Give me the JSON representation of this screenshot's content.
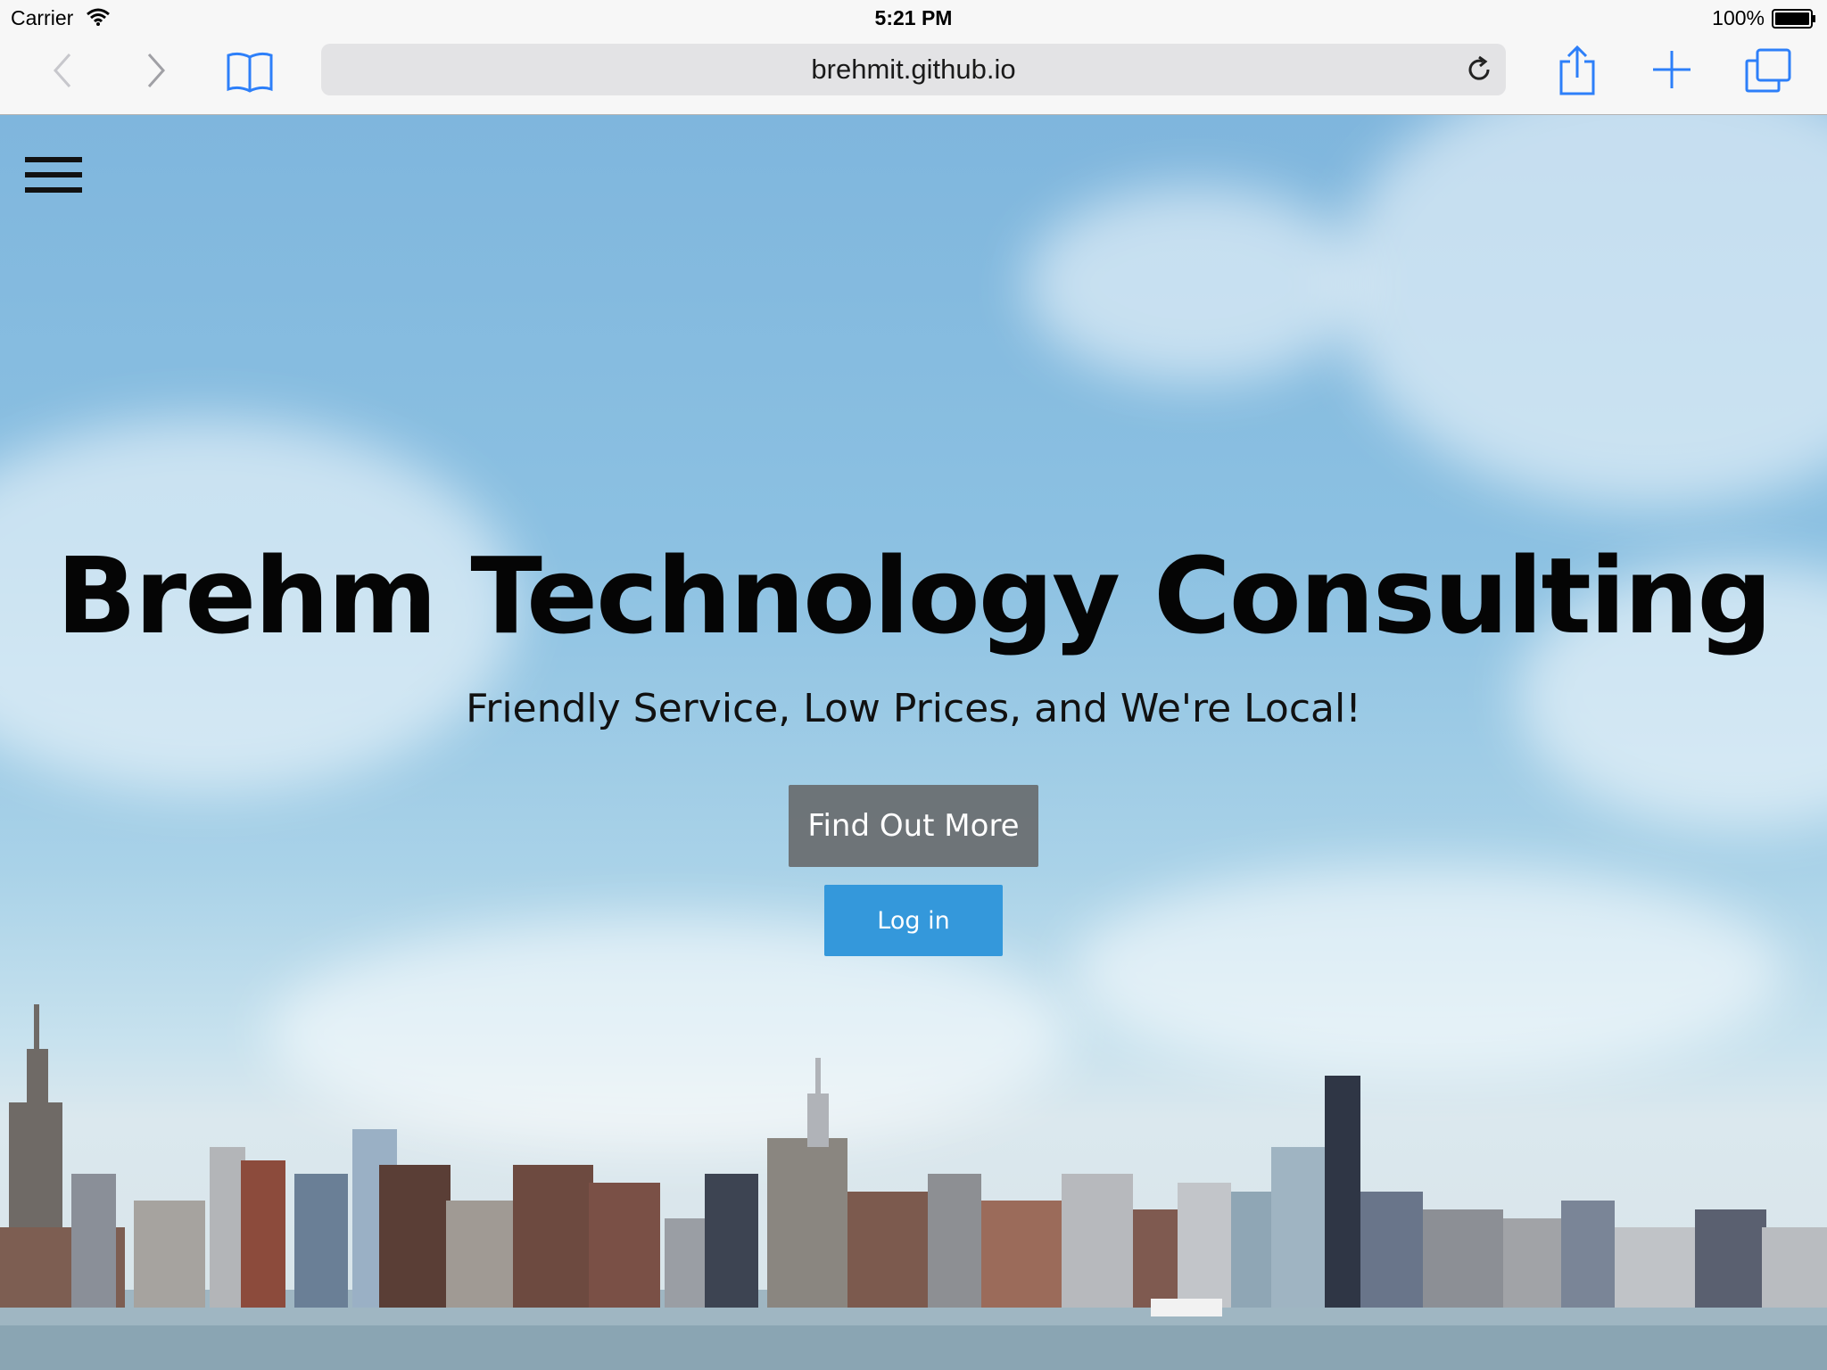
{
  "status_bar": {
    "carrier": "Carrier",
    "time": "5:21 PM",
    "battery": "100%"
  },
  "toolbar": {
    "url": "brehmit.github.io",
    "icons": [
      "back-icon",
      "forward-icon",
      "bookmarks-icon",
      "reload-icon",
      "share-icon",
      "add-tab-icon",
      "tabs-icon"
    ],
    "accent_color": "#2d7ff9"
  },
  "page": {
    "title": "Brehm Technology Consulting",
    "subtitle": "Friendly Service, Low Prices, and We're Local!",
    "find_out_more_label": "Find Out More",
    "login_label": "Log in",
    "login_color": "#3498db"
  }
}
